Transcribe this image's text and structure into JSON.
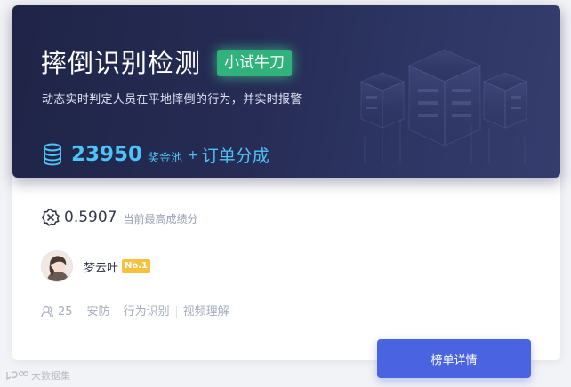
{
  "competition": {
    "title": "摔倒识别检测",
    "tag": "小试牛刀",
    "description": "动态实时判定人员在平地摔倒的行为，并实时报警",
    "prize": {
      "amount": "23950",
      "label": "奖金池",
      "plus": "+",
      "extra": "订单分成"
    }
  },
  "leaderboard": {
    "best_score": "0.5907",
    "best_score_label": "当前最高成绩分",
    "leader_name": "梦云叶",
    "leader_rank": "No.1"
  },
  "meta": {
    "participants": "25",
    "tags": [
      "安防",
      "行为识别",
      "视频理解"
    ]
  },
  "actions": {
    "details_label": "榜单详情"
  },
  "watermark": {
    "text": "大数据集"
  },
  "colors": {
    "hero_background": "#262c55",
    "tag_green": "#2fb37a",
    "prize_blue": "#4fc3f7",
    "badge_gold": "#f6c23e",
    "button_blue": "#4a63e0"
  },
  "icons": {
    "prize": "coin-stack-icon",
    "score": "score-badge-icon",
    "participants": "people-icon",
    "watermark": "brand-logo-icon"
  }
}
